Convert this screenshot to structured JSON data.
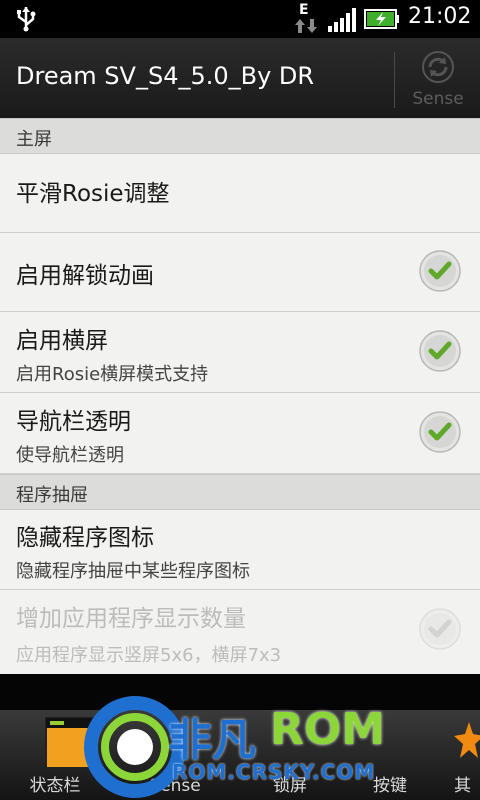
{
  "status_bar": {
    "network_type": "E",
    "time": "21:02"
  },
  "header": {
    "title": "Dream SV_S4_5.0_By DR",
    "sense_label": "Sense"
  },
  "sections": [
    {
      "title": "主屏"
    },
    {
      "title": "程序抽屉"
    }
  ],
  "rows": [
    {
      "title": "平滑Rosie调整",
      "subtitle": ""
    },
    {
      "title": "启用解锁动画",
      "subtitle": "",
      "checked": true
    },
    {
      "title": "启用横屏",
      "subtitle": "启用Rosie横屏模式支持",
      "checked": true
    },
    {
      "title": "导航栏透明",
      "subtitle": "使导航栏透明",
      "checked": true
    },
    {
      "title": "隐藏程序图标",
      "subtitle": "隐藏程序抽屉中某些程序图标"
    },
    {
      "title": "增加应用程序显示数量",
      "subtitle": "应用程序显示竖屏5x6，横屏7x3",
      "checked": true,
      "disabled": true
    }
  ],
  "bottom_tabs": [
    {
      "label": "状态栏"
    },
    {
      "label": "Sense"
    },
    {
      "label": "锁屏"
    },
    {
      "label": "按键"
    },
    {
      "label": "其"
    }
  ],
  "watermark": {
    "brand_a": "非凡",
    "brand_b": "ROM",
    "url": "ROM.CRSKY.COM"
  },
  "colors": {
    "check_green": "#5fa82a",
    "watermark_blue": "#1f6fd0",
    "watermark_green": "#8dd63a"
  }
}
